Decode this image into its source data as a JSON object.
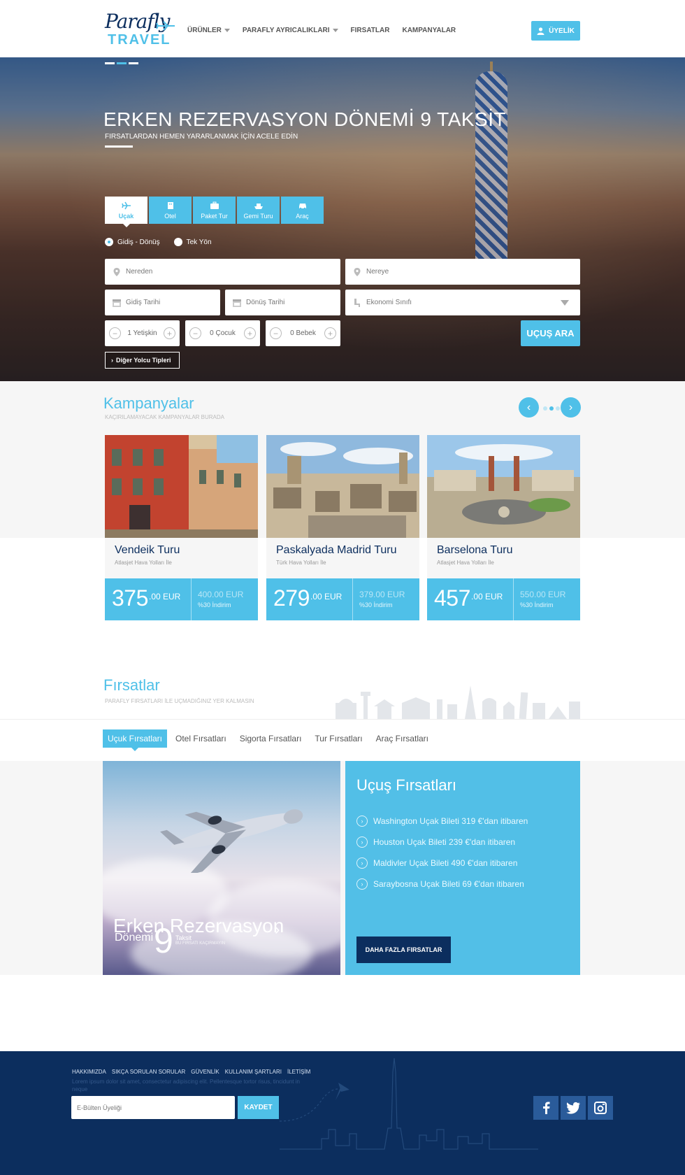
{
  "header": {
    "logo_top": "Parafly",
    "logo_bottom": "TRAVEL",
    "nav": [
      {
        "label": "ÜRÜNLER",
        "dropdown": true
      },
      {
        "label": "PARAFLY AYRICALIKLARI",
        "dropdown": true
      },
      {
        "label": "FIRSATLAR",
        "dropdown": false
      },
      {
        "label": "KAMPANYALAR",
        "dropdown": false
      }
    ],
    "member_label": "ÜYELİK"
  },
  "hero": {
    "title": "ERKEN REZERVASYON DÖNEMİ 9 TAKSİT",
    "subtitle": "FIRSATLARDAN HEMEN YARARLANMAK İÇİN ACELE EDİN",
    "tabs": [
      "Uçak",
      "Otel",
      "Paket Tur",
      "Gemi Turu",
      "Araç"
    ],
    "active_tab": "Uçak",
    "trip_types": [
      "Gidiş - Dönüş",
      "Tek Yön"
    ],
    "selected_trip": "Gidiş - Dönüş",
    "from_placeholder": "Nereden",
    "to_placeholder": "Nereye",
    "depart_placeholder": "Gidiş Tarihi",
    "return_placeholder": "Dönüş Tarihi",
    "class_value": "Ekonomi Sınıfı",
    "adults": "1 Yetişkin",
    "children": "0 Çocuk",
    "infants": "0 Bebek",
    "search_label": "UÇUŞ ARA",
    "other_label": "Diğer Yolcu Tipleri"
  },
  "campaigns": {
    "title": "Kampanyalar",
    "subtitle": "KAÇIRILAMAYACAK KAMPANYALAR BURADA",
    "cards": [
      {
        "title": "Vendeik Turu",
        "airline": "Atlasjet Hava Yolları İle",
        "price": "375",
        "cents": ".00 EUR",
        "old_price": "400.00 EUR",
        "discount": "%30 İndirim"
      },
      {
        "title": "Paskalyada Madrid Turu",
        "airline": "Türk Hava Yolları İle",
        "price": "279",
        "cents": ".00 EUR",
        "old_price": "379.00 EUR",
        "discount": "%30 İndirim"
      },
      {
        "title": "Barselona Turu",
        "airline": "Atlasjet Hava Yolları İle",
        "price": "457",
        "cents": ".00 EUR",
        "old_price": "550.00 EUR",
        "discount": "%30 İndirim"
      }
    ]
  },
  "deals": {
    "title": "Fırsatlar",
    "subtitle": "PARAFLY FIRSATLARI İLE UÇMADIĞINIZ YER KALMASIN",
    "tabs": [
      "Uçuk Fırsatları",
      "Otel Fırsatları",
      "Sigorta Fırsatları",
      "Tur Fırsatları",
      "Araç Fırsatları"
    ],
    "active_tab": "Uçuk Fırsatları",
    "promo": {
      "line1": "Erken Rezervasyon",
      "line2": "Dönemi",
      "number": "9",
      "installment": "Taksit",
      "fine": "BU FIRSATI KAÇIRMAYIN"
    },
    "panel_title": "Uçuş Fırsatları",
    "items": [
      "Washington Uçak Bileti 319 €'dan itibaren",
      "Houston Uçak Bileti 239 €'dan itibaren",
      "Maldivler Uçak Bileti 490 €'dan itibaren",
      "Saraybosna Uçak Bileti 69 €'dan itibaren"
    ],
    "more_label": "DAHA FAZLA FIRSATLAR"
  },
  "footer": {
    "links": [
      "HAKKIMIZDA",
      "SIKÇA SORULAN SORULAR",
      "GÜVENLİK",
      "KULLANIM ŞARTLARI",
      "İLETİŞİM"
    ],
    "lorem": "Lorem ipsum dolor sit amet, consectetur adipiscing elit. Pellentesque tortor risus, tincidunt in neque",
    "newsletter_placeholder": "E-Bülten Üyeliği",
    "subscribe_label": "KAYDET",
    "social": [
      "facebook-icon",
      "twitter-icon",
      "instagram-icon"
    ]
  },
  "colors": {
    "accent": "#4fc0e8",
    "navy": "#0c2e5e"
  }
}
